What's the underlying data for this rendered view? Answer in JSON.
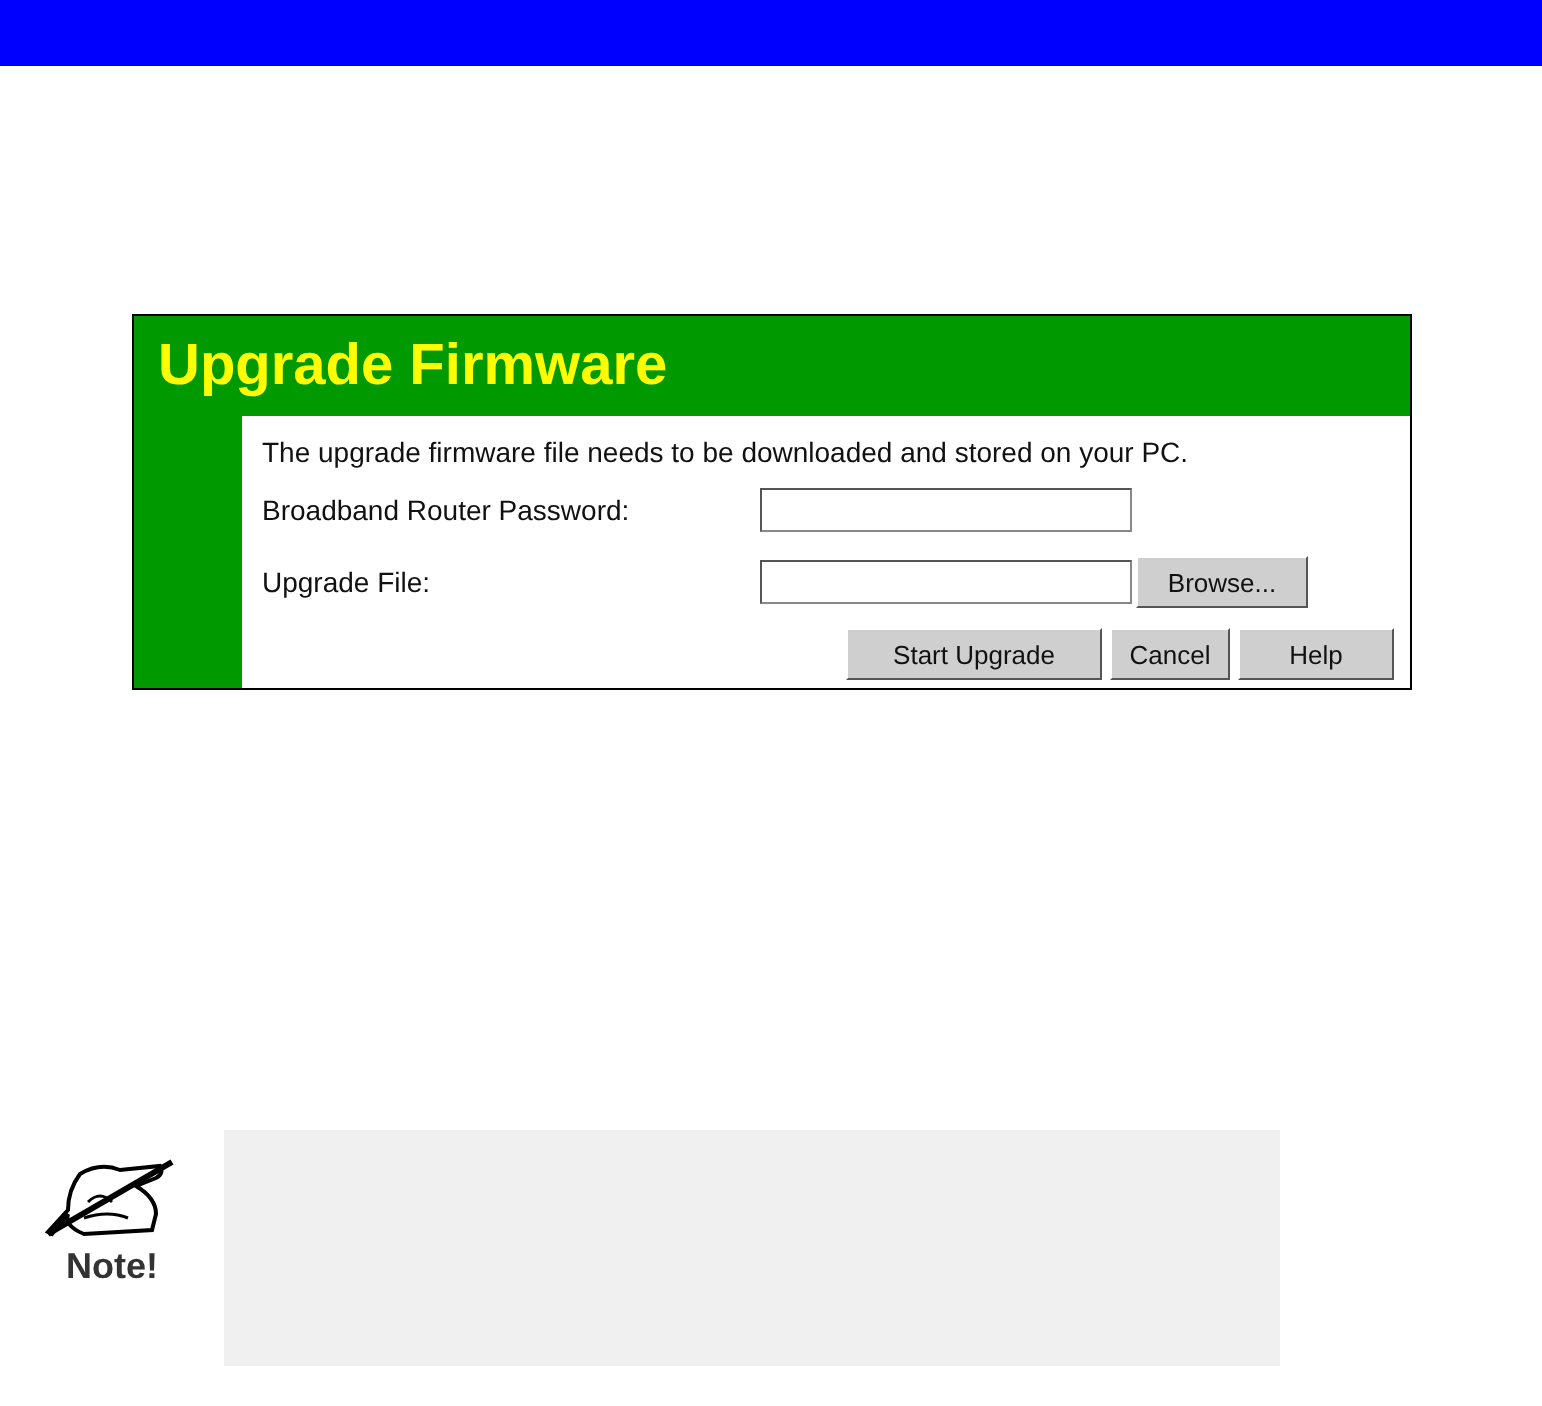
{
  "panel": {
    "title": "Upgrade Firmware",
    "description": "The upgrade firmware file needs to be downloaded and stored on your PC.",
    "fields": [
      {
        "label": "Broadband Router Password:",
        "kind": "password"
      },
      {
        "label": "Upgrade File:",
        "kind": "file",
        "button": "Browse..."
      }
    ],
    "buttons": [
      "Start Upgrade",
      "Cancel",
      "Help"
    ]
  },
  "note": {
    "label": "Note!"
  }
}
